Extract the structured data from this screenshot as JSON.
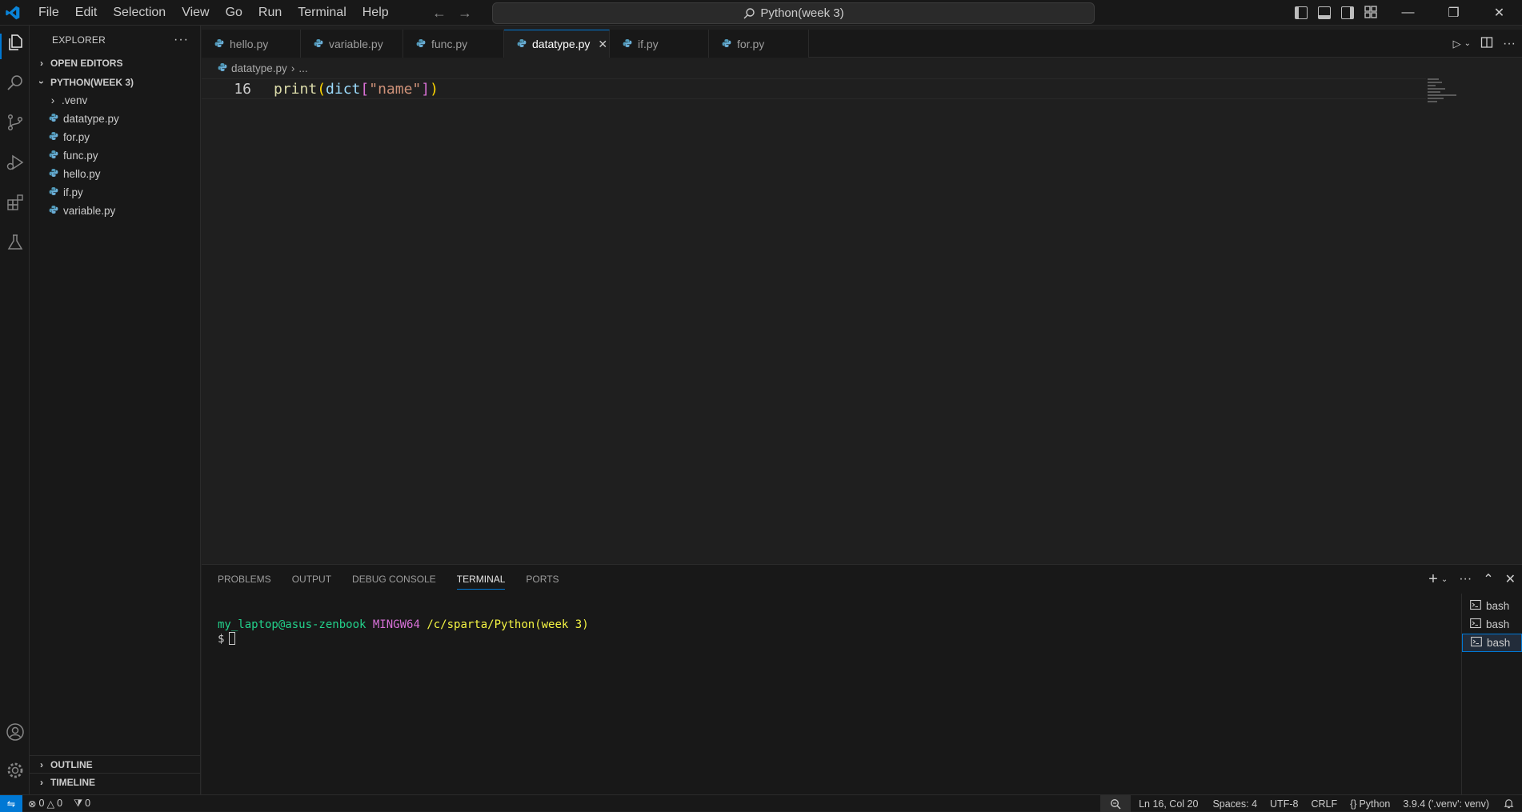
{
  "titlebar": {
    "menu": [
      "File",
      "Edit",
      "Selection",
      "View",
      "Go",
      "Run",
      "Terminal",
      "Help"
    ],
    "search_text": "Python(week 3)"
  },
  "sidebar": {
    "title": "EXPLORER",
    "sections": {
      "open_editors": "OPEN EDITORS",
      "folder": "PYTHON(WEEK 3)",
      "outline": "OUTLINE",
      "timeline": "TIMELINE"
    },
    "folder_items": [
      ".venv"
    ],
    "files": [
      "datatype.py",
      "for.py",
      "func.py",
      "hello.py",
      "if.py",
      "variable.py"
    ]
  },
  "tabs": [
    "hello.py",
    "variable.py",
    "func.py",
    "datatype.py",
    "if.py",
    "for.py"
  ],
  "active_tab": "datatype.py",
  "breadcrumb": {
    "file": "datatype.py",
    "more": "..."
  },
  "editor": {
    "line_number": "16",
    "tokens": {
      "fn": "print",
      "open": "(",
      "var": "dict",
      "lbrk": "[",
      "str": "\"name\"",
      "rbrk": "]",
      "close": ")"
    }
  },
  "panel": {
    "tabs": [
      "PROBLEMS",
      "OUTPUT",
      "DEBUG CONSOLE",
      "TERMINAL",
      "PORTS"
    ],
    "active_tab": "TERMINAL",
    "terminal": {
      "user": "my_laptop@asus-zenbook",
      "system": "MINGW64",
      "path": "/c/sparta/Python(week 3)",
      "prompt": "$"
    },
    "terminals": [
      "bash",
      "bash",
      "bash"
    ]
  },
  "statusbar": {
    "errors": "0",
    "warnings": "0",
    "ports": "0",
    "position": "Ln 16, Col 20",
    "spaces": "Spaces: 4",
    "encoding": "UTF-8",
    "eol": "CRLF",
    "language": "Python",
    "interpreter": "3.9.4 ('.venv': venv)"
  },
  "colors": {
    "accent": "#0078d4",
    "background": "#1f1f1f",
    "chrome": "#181818"
  }
}
